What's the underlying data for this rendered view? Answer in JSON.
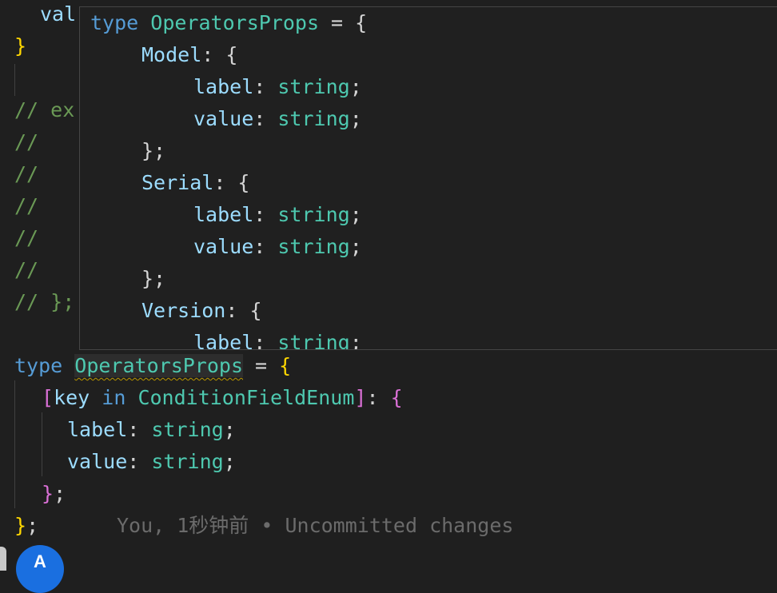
{
  "editor": {
    "line_val": "val",
    "close_brace_top": "}",
    "comment_ex": "// ex",
    "comment_slash": "//",
    "comment_end": "// };",
    "type_kw": "type",
    "type_name": "OperatorsProps",
    "assign": " = ",
    "open_brace": "{",
    "mapped_open": "[",
    "mapped_key": "key",
    "mapped_in": "in",
    "mapped_enum": "ConditionFieldEnum",
    "mapped_close": "]",
    "colon_sp": ": ",
    "label_prop": "label",
    "value_prop": "value",
    "string_type": "string",
    "semicolon": ";",
    "colon": ":",
    "inner_close": "}",
    "outer_close": "}",
    "blame_text": "You, 1秒钟前 • Uncommitted changes"
  },
  "hover": {
    "type_kw": "type",
    "type_name": "OperatorsProps",
    "assign": " = {",
    "model_key": "Model",
    "serial_key": "Serial",
    "version_key": "Version",
    "label_prop": "label",
    "value_prop": "value",
    "string_type": "string",
    "obj_open": ": {",
    "obj_close": "};",
    "colon": ": ",
    "semicolon": ";"
  },
  "statusbar": {
    "avatar_letter": "A"
  },
  "colors": {
    "background": "#1f1f1f",
    "keyword": "#569cd6",
    "type": "#4ec9b0",
    "property": "#9cdcfe",
    "comment": "#6a9955",
    "bracket_level1": "#ffd700",
    "bracket_level2": "#da70d6",
    "badge": "#1a6fe0"
  }
}
